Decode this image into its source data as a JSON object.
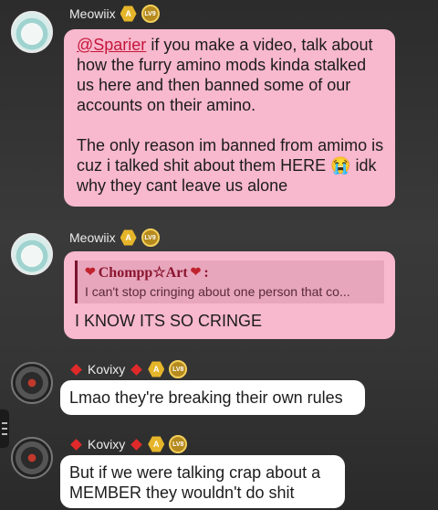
{
  "messages": [
    {
      "username": "Meowiix",
      "badge_a": "A",
      "badge_lv": "LV9",
      "mention": "@Sparier",
      "paragraph1": " if you make a video, talk about how the furry amino mods kinda stalked us here and then banned some of our accounts on their amino.",
      "paragraph2": "The only reason im banned from amimo is cuz i talked shit about them HERE 😭 idk why they cant leave us alone"
    },
    {
      "username": "Meowiix",
      "badge_a": "A",
      "badge_lv": "LV9",
      "quote_author": "Chompp☆Art",
      "quote_suffix": ":",
      "quote_text": "I can't stop cringing about one person that co...",
      "text": "I KNOW ITS SO CRINGE"
    },
    {
      "username": "Kovixy",
      "badge_a": "A",
      "badge_lv": "LV8",
      "text": "Lmao they're breaking their own rules"
    },
    {
      "username": "Kovixy",
      "badge_a": "A",
      "badge_lv": "LV8",
      "text": "But if we were talking crap about a MEMBER they wouldn't do shit"
    }
  ],
  "colors": {
    "pink_bubble": "#f8b8cd",
    "white_bubble": "#ffffff",
    "mention": "#c4163a"
  }
}
